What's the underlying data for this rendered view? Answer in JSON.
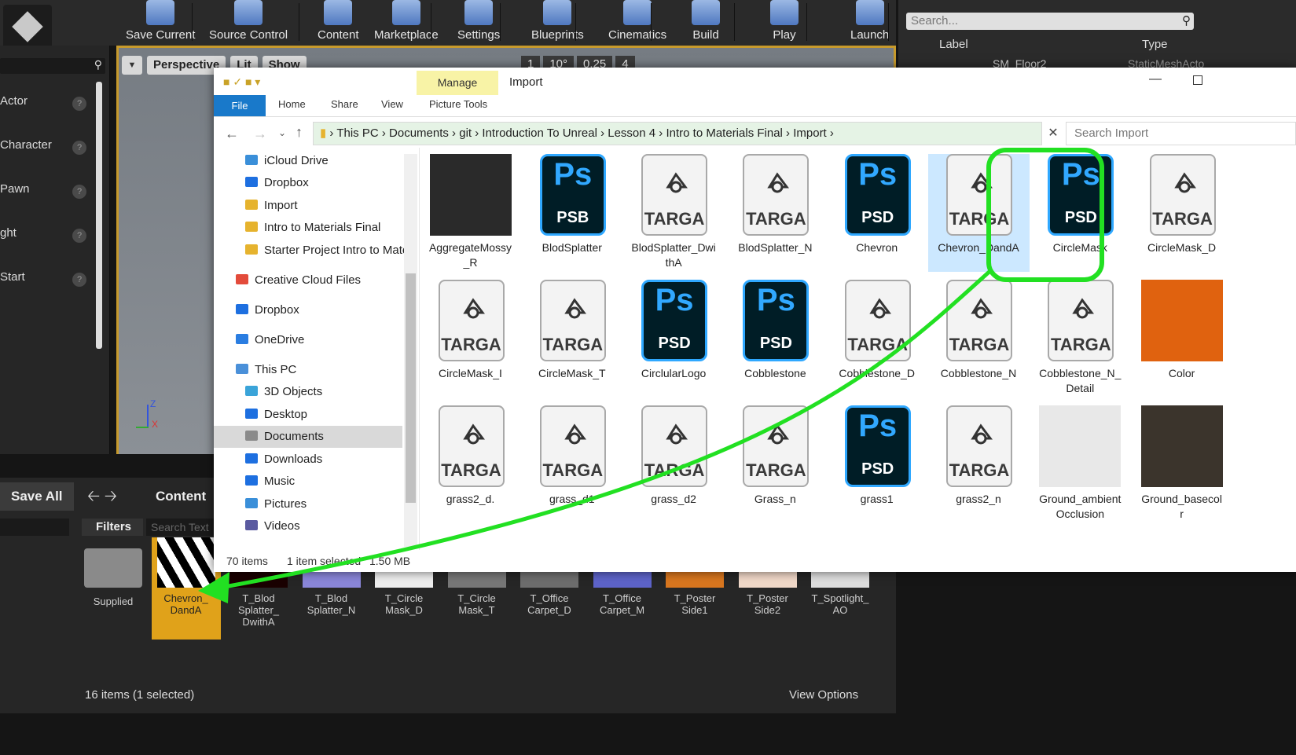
{
  "ue": {
    "toolbar": [
      {
        "label": "Save Current"
      },
      {
        "label": "Source Control"
      },
      {
        "label": "Content"
      },
      {
        "label": "Marketplace"
      },
      {
        "label": "Settings"
      },
      {
        "label": "Blueprints"
      },
      {
        "label": "Cinematics"
      },
      {
        "label": "Build"
      },
      {
        "label": "Play"
      },
      {
        "label": "Launch"
      }
    ],
    "modes": [
      "Actor",
      "Character",
      "Pawn",
      "ght",
      "Start"
    ],
    "viewport": {
      "perspective": "Perspective",
      "lit": "Lit",
      "show": "Show",
      "grid": "1",
      "angle": "10°",
      "scale": "0.25",
      "cam": "4"
    },
    "outliner": {
      "search": "Search...",
      "col_label": "Label",
      "col_type": "Type",
      "row_label": "SM_Floor2",
      "row_type": "StaticMeshActo"
    },
    "cb": {
      "save_all": "Save All",
      "content": "Content",
      "filters": "Filters",
      "search": "Search Text",
      "status": "16 items (1 selected)",
      "view_options": "View Options",
      "tiles": [
        {
          "name": "Supplied",
          "color": "#8a8a8a"
        },
        {
          "name": "Chevron_\nDandA",
          "color": "#000"
        },
        {
          "name": "T_Blod\nSplatter_\nDwithA",
          "color": "#1a0000"
        },
        {
          "name": "T_Blod\nSplatter_N",
          "color": "#8a86d9"
        },
        {
          "name": "T_Circle\nMask_D",
          "color": "#eee"
        },
        {
          "name": "T_Circle\nMask_T",
          "color": "#777"
        },
        {
          "name": "T_Office\nCarpet_D",
          "color": "#6d6d6d"
        },
        {
          "name": "T_Office\nCarpet_M",
          "color": "#5d63c9"
        },
        {
          "name": "T_Poster\nSide1",
          "color": "#d8761f"
        },
        {
          "name": "T_Poster\nSide2",
          "color": "#f0d8c8"
        },
        {
          "name": "T_Spotlight_\nAO",
          "color": "#ddd"
        }
      ]
    }
  },
  "explorer": {
    "title": "Import",
    "manage": "Manage",
    "tabs": [
      "File",
      "Home",
      "Share",
      "View",
      "Picture Tools"
    ],
    "breadcrumb": [
      "This PC",
      "Documents",
      "git",
      "Introduction To Unreal",
      "Lesson 4",
      "Intro to Materials Final",
      "Import"
    ],
    "search": "Search Import",
    "nav": [
      "iCloud Drive",
      "Dropbox",
      "Import",
      "Intro to Materials Final",
      "Starter Project Intro to Materi",
      "Creative Cloud Files",
      "Dropbox",
      "OneDrive",
      "This PC",
      "3D Objects",
      "Desktop",
      "Documents",
      "Downloads",
      "Music",
      "Pictures",
      "Videos"
    ],
    "files": [
      {
        "name": "AggregateMossy\n_R",
        "kind": "img",
        "color": "#2a2a2a"
      },
      {
        "name": "BlodSplatter",
        "kind": "ps",
        "ext": "PSB"
      },
      {
        "name": "BlodSplatter_Dwi\nthA",
        "kind": "tga"
      },
      {
        "name": "BlodSplatter_N",
        "kind": "tga"
      },
      {
        "name": "Chevron",
        "kind": "ps",
        "ext": "PSD"
      },
      {
        "name": "Chevron_DandA",
        "kind": "tga",
        "selected": true
      },
      {
        "name": "CircleMask",
        "kind": "ps",
        "ext": "PSD"
      },
      {
        "name": "CircleMask_D",
        "kind": "tga"
      },
      {
        "name": "CircleMask_I",
        "kind": "tga"
      },
      {
        "name": "CircleMask_T",
        "kind": "tga"
      },
      {
        "name": "CirclularLogo",
        "kind": "ps",
        "ext": "PSD"
      },
      {
        "name": "Cobblestone",
        "kind": "ps",
        "ext": "PSD"
      },
      {
        "name": "Cobblestone_D",
        "kind": "tga"
      },
      {
        "name": "Cobblestone_N",
        "kind": "tga"
      },
      {
        "name": "Cobblestone_N_\nDetail",
        "kind": "tga"
      },
      {
        "name": "Color",
        "kind": "img",
        "color": "#e0620f"
      },
      {
        "name": "grass2_d.",
        "kind": "tga"
      },
      {
        "name": "grass_d1",
        "kind": "tga"
      },
      {
        "name": "grass_d2",
        "kind": "tga"
      },
      {
        "name": "Grass_n",
        "kind": "tga"
      },
      {
        "name": "grass1",
        "kind": "ps",
        "ext": "PSD"
      },
      {
        "name": "grass2_n",
        "kind": "tga"
      },
      {
        "name": "Ground_ambient\nOcclusion",
        "kind": "img",
        "color": "#e8e8e8"
      },
      {
        "name": "Ground_basecol\nr",
        "kind": "img",
        "color": "#3b342c"
      }
    ],
    "tga_label": "TARGA",
    "status": {
      "count": "70 items",
      "selected": "1 item selected",
      "size": "1.50 MB"
    }
  }
}
